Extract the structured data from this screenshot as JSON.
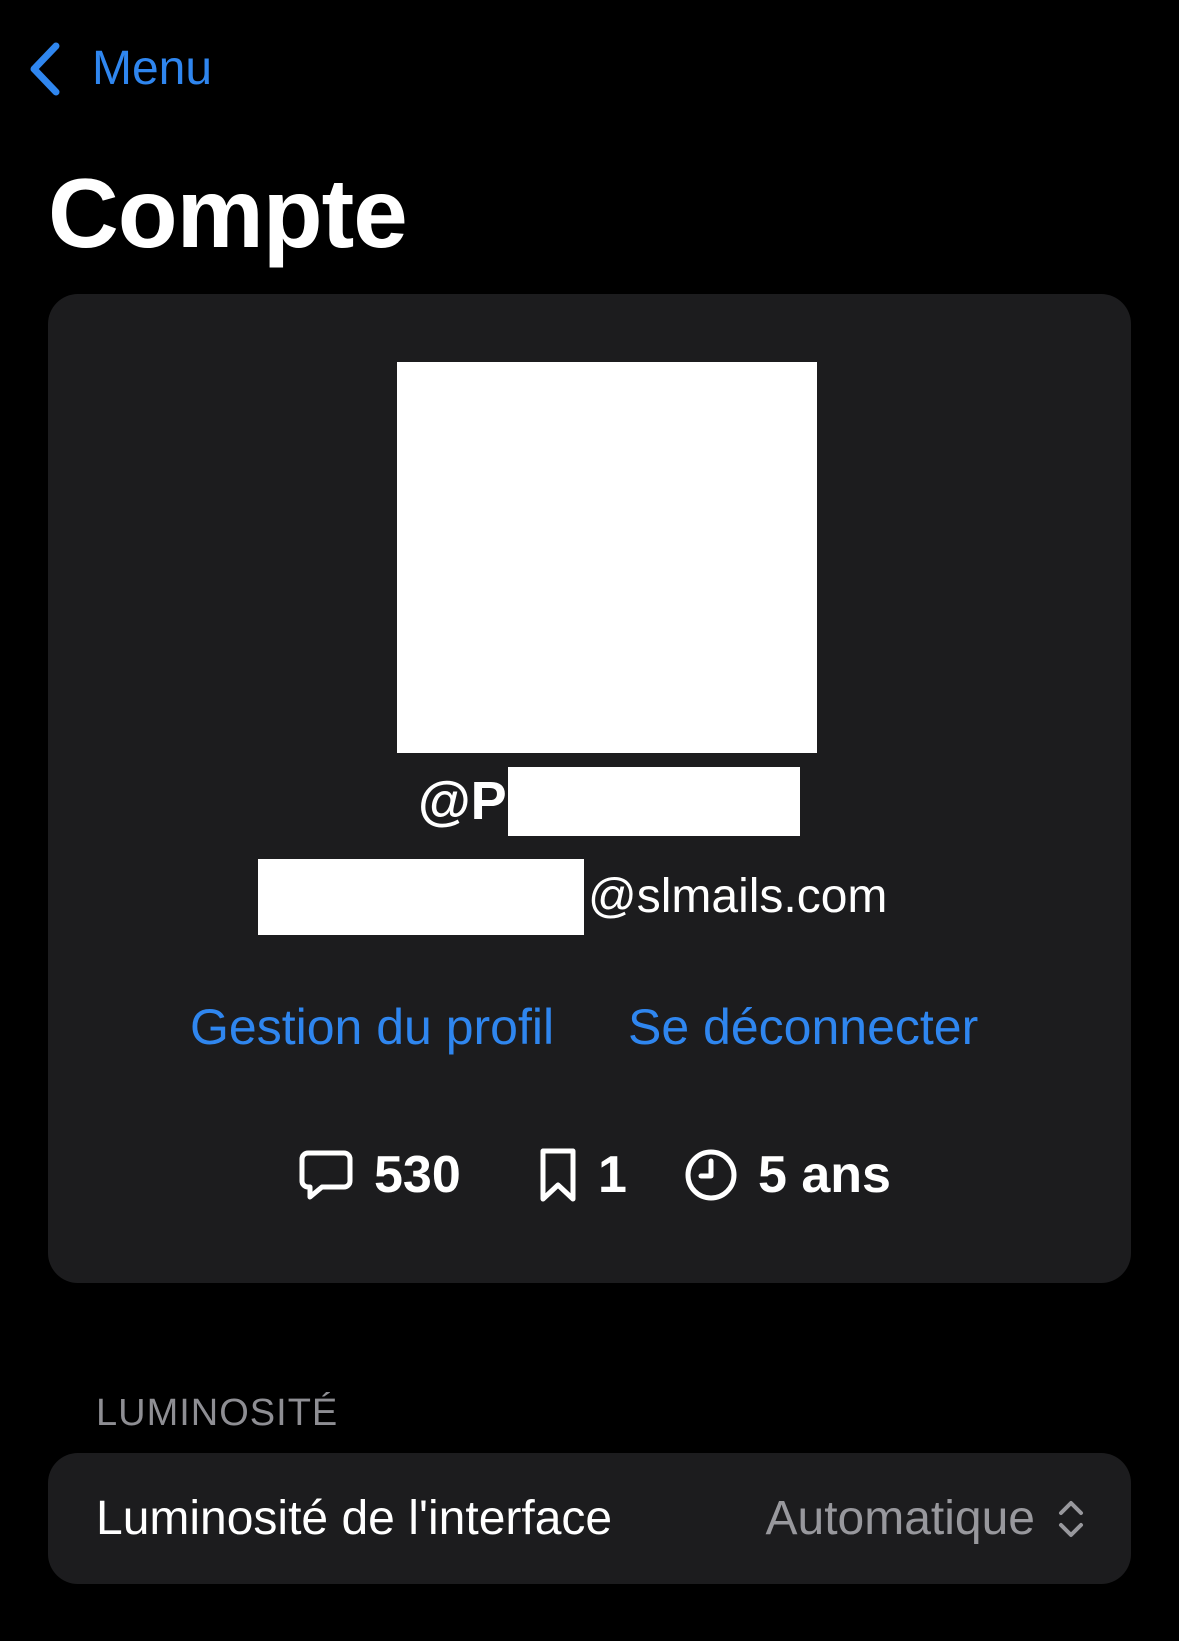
{
  "nav": {
    "back_label": "Menu"
  },
  "page": {
    "title": "Compte"
  },
  "profile": {
    "username_visible": "@P",
    "email_domain": "@slmails.com",
    "links": {
      "manage_profile": "Gestion du profil",
      "logout": "Se déconnecter"
    },
    "stats": {
      "comments": "530",
      "bookmarks": "1",
      "account_age": "5 ans"
    }
  },
  "brightness_section": {
    "header": "LUMINOSITÉ",
    "setting_label": "Luminosité de l'interface",
    "setting_value": "Automatique"
  },
  "colors": {
    "accent": "#2f86ef",
    "background": "#000000",
    "card": "#1c1c1e",
    "secondary_text": "#8e8e93"
  },
  "icons": {
    "back": "chevron-left-icon",
    "comments": "speech-bubble-icon",
    "bookmarks": "bookmark-icon",
    "age": "clock-icon",
    "picker": "chevron-up-down-icon"
  }
}
